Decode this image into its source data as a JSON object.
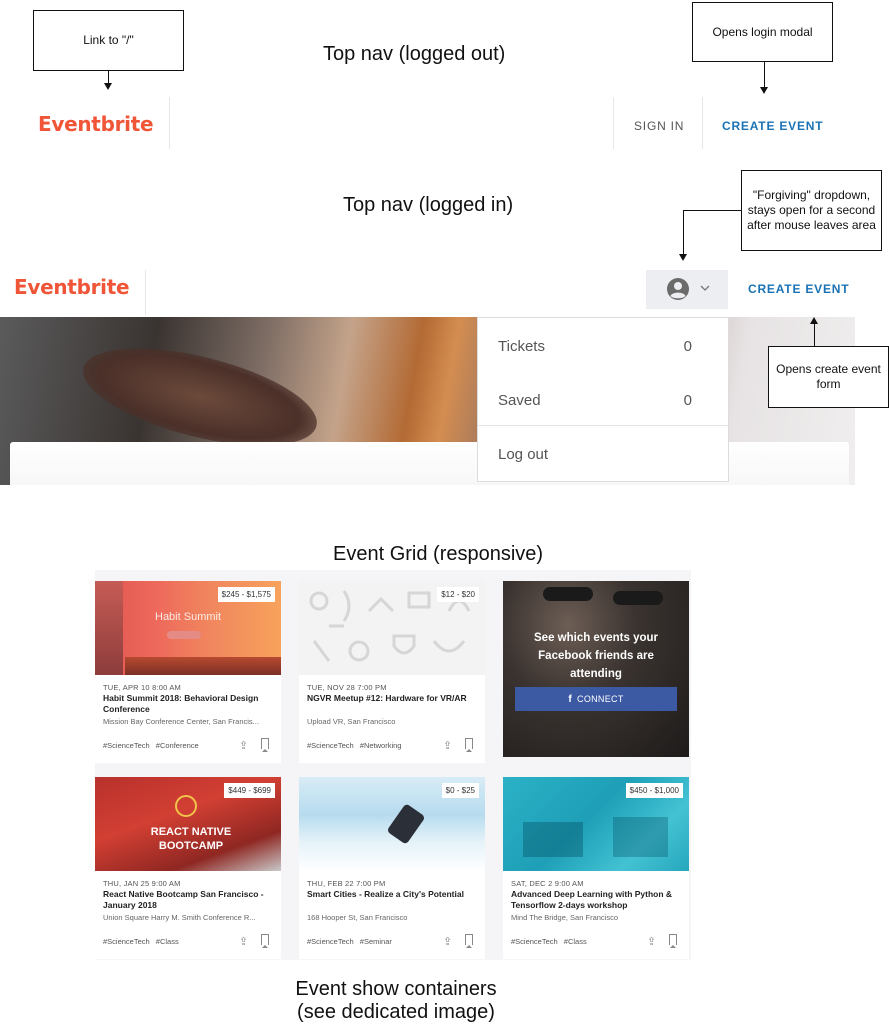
{
  "sections": {
    "nav_logged_out": "Top nav (logged out)",
    "nav_logged_in": "Top nav (logged in)",
    "event_grid": "Event Grid (responsive)",
    "event_show": "Event show containers\n(see dedicated image)"
  },
  "annotations": {
    "logo_link": "Link to \"/\"",
    "login_modal": "Opens login modal",
    "forgiving_dropdown": "\"Forgiving\" dropdown, stays open for a second after mouse leaves area",
    "create_event_form": "Opens create event form"
  },
  "nav": {
    "logo": "Eventbrite",
    "sign_in": "SIGN IN",
    "create_event": "CREATE EVENT"
  },
  "dropdown": {
    "items": [
      {
        "label": "Tickets",
        "count": "0"
      },
      {
        "label": "Saved",
        "count": "0"
      },
      {
        "label": "Log out"
      }
    ]
  },
  "colors": {
    "brand": "#f05537",
    "link": "#1a73b5",
    "facebook": "#3b5aa3"
  },
  "events": [
    {
      "price": "$245 - $1,575",
      "date": "TUE, APR 10 8:00 AM",
      "title": "Habit Summit 2018: Behavioral Design Conference",
      "venue": "Mission Bay Conference Center, San Francis...",
      "tags": "#ScienceTech #Conference",
      "image_text": "Habit Summit"
    },
    {
      "price": "$12 - $20",
      "date": "TUE, NOV 28 7:00 PM",
      "title": "NGVR Meetup #12: Hardware for VR/AR",
      "venue": "Upload VR, San Francisco",
      "tags": "#ScienceTech #Networking"
    },
    {
      "price": "$449 - $699",
      "date": "THU, JAN 25 9:00 AM",
      "title": "React Native Bootcamp San Francisco - January 2018",
      "venue": "Union Square Harry M. Smith Conference R...",
      "tags": "#ScienceTech #Class",
      "image_text": "REACT NATIVE BOOTCAMP"
    },
    {
      "price": "$0 - $25",
      "date": "THU, FEB 22 7:00 PM",
      "title": "Smart Cities - Realize a City's Potential",
      "venue": "168 Hooper St, San Francisco",
      "tags": "#ScienceTech #Seminar"
    },
    {
      "price": "$450 - $1,000",
      "date": "SAT, DEC 2 9:00 AM",
      "title": "Advanced Deep Learning with Python & Tensorflow 2-days workshop",
      "venue": "Mind The Bridge, San Francisco",
      "tags": "#ScienceTech #Class"
    }
  ],
  "facebook_card": {
    "text": "See which events your Facebook friends are attending",
    "button": "CONNECT"
  }
}
